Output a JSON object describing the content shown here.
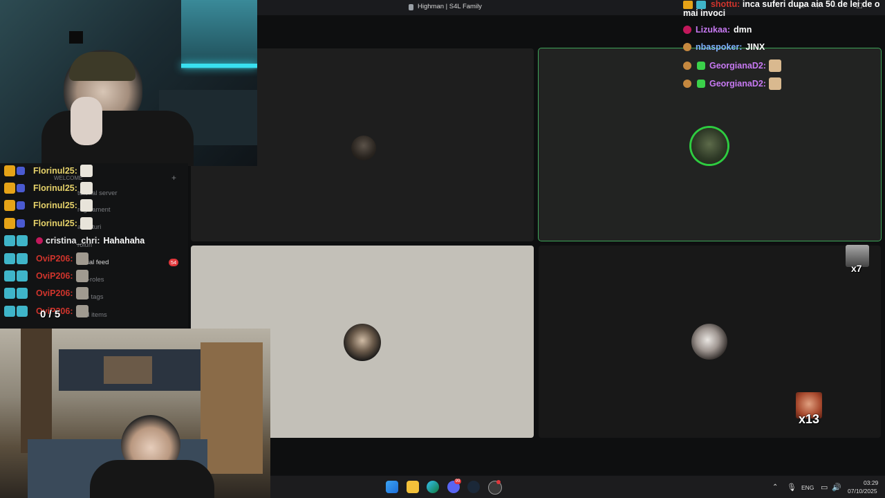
{
  "window": {
    "title": "Highman | S4L Family"
  },
  "window_controls": {
    "minimize": "–",
    "maximize": "☐",
    "close": "✕"
  },
  "stream": {
    "challenge_counter": "0 / 5"
  },
  "discord_sidebar": {
    "header": "WELCOME",
    "channels": [
      "tutorial server",
      "regulament",
      "anunturi",
      "roluri",
      "social feed",
      "self-roles",
      "skin tags",
      "sold items"
    ],
    "mention_badge": "54",
    "add_icon": "+"
  },
  "chat_left": [
    {
      "user": "Florinul25:",
      "message": "",
      "color": "#e6d26a",
      "has_emote": true
    },
    {
      "user": "Florinul25:",
      "message": "",
      "color": "#e6d26a",
      "has_emote": true
    },
    {
      "user": "Florinul25:",
      "message": "",
      "color": "#e6d26a",
      "has_emote": true
    },
    {
      "user": "Florinul25:",
      "message": "",
      "color": "#e6d26a",
      "has_emote": true
    },
    {
      "user": "cristina_chri:",
      "message": "Hahahaha",
      "color": "#e8e8e8",
      "has_emote": false
    },
    {
      "user": "OviP206:",
      "message": "",
      "color": "#d0342c",
      "has_emote": true
    },
    {
      "user": "OviP206:",
      "message": "",
      "color": "#d0342c",
      "has_emote": true
    },
    {
      "user": "OviP206:",
      "message": "",
      "color": "#d0342c",
      "has_emote": true
    },
    {
      "user": "OviP206:",
      "message": "",
      "color": "#d0342c",
      "has_emote": true
    }
  ],
  "chat_right": [
    {
      "user": "Lizukaa:",
      "message": "dmn",
      "color": "#c779f2"
    },
    {
      "user": "nbaspoker:",
      "message": "JINX",
      "color": "#7fb2ff"
    },
    {
      "user": "GeorgianaD2:",
      "message": "",
      "color": "#c779f2"
    },
    {
      "user": "GeorgianaD2:",
      "message": "",
      "color": "#c779f2"
    }
  ],
  "chat_right_top": {
    "user": "shottu:",
    "message": "inca suferi dupa aia 50 de lei de o mai invoci"
  },
  "emote_counters": {
    "top": "x7",
    "bottom": "x13"
  },
  "taskbar": {
    "tray_lang": "ENG",
    "time": "03:29",
    "date": "07/10/2025",
    "discord_badge": "99"
  },
  "colors": {
    "speaking_outline": "#3fa65a",
    "accent": "#5865f2"
  }
}
